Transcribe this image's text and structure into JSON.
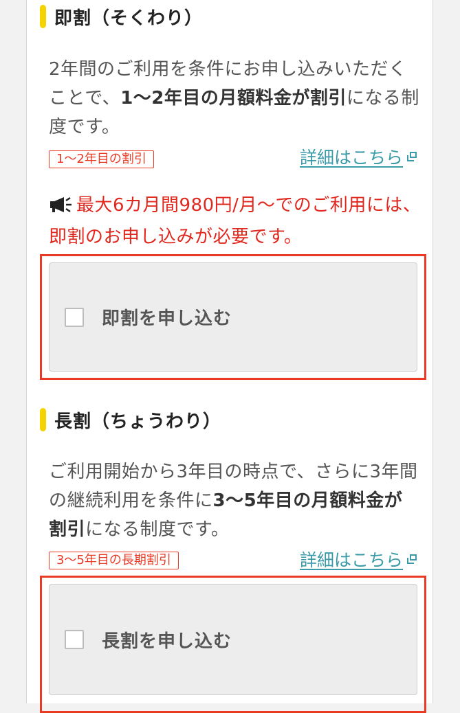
{
  "sokuwari": {
    "title": "即割（そくわり）",
    "desc_part1": "2年間のご利用を条件にお申し込みいただくことで、",
    "desc_bold": "1〜2年目の月額料金が割引",
    "desc_part2": "になる制度です。",
    "tag": "1〜2年目の割引",
    "detail_link": "詳細はこちら",
    "notice": "最大6カ月間980円/月〜でのご利用には、即割のお申し込みが必要です。",
    "apply_label": "即割を申し込む",
    "apply_checked": false
  },
  "chouwari": {
    "title": "長割（ちょうわり）",
    "desc_part1": "ご利用開始から3年目の時点で、さらに3年間の継続利用を条件に",
    "desc_bold": "3〜5年目の月額料金が割引",
    "desc_part2": "になる制度です。",
    "tag": "3〜5年目の長期割引",
    "detail_link": "詳細はこちら",
    "apply_label": "長割を申し込む",
    "apply_checked": false
  },
  "colors": {
    "accent_yellow": "#f5d300",
    "alert_red": "#e83a25",
    "link_teal": "#3a9aa8"
  },
  "icons": {
    "external_link": "external-link-icon",
    "notice": "megaphone-icon",
    "checkbox": "checkbox-icon"
  }
}
